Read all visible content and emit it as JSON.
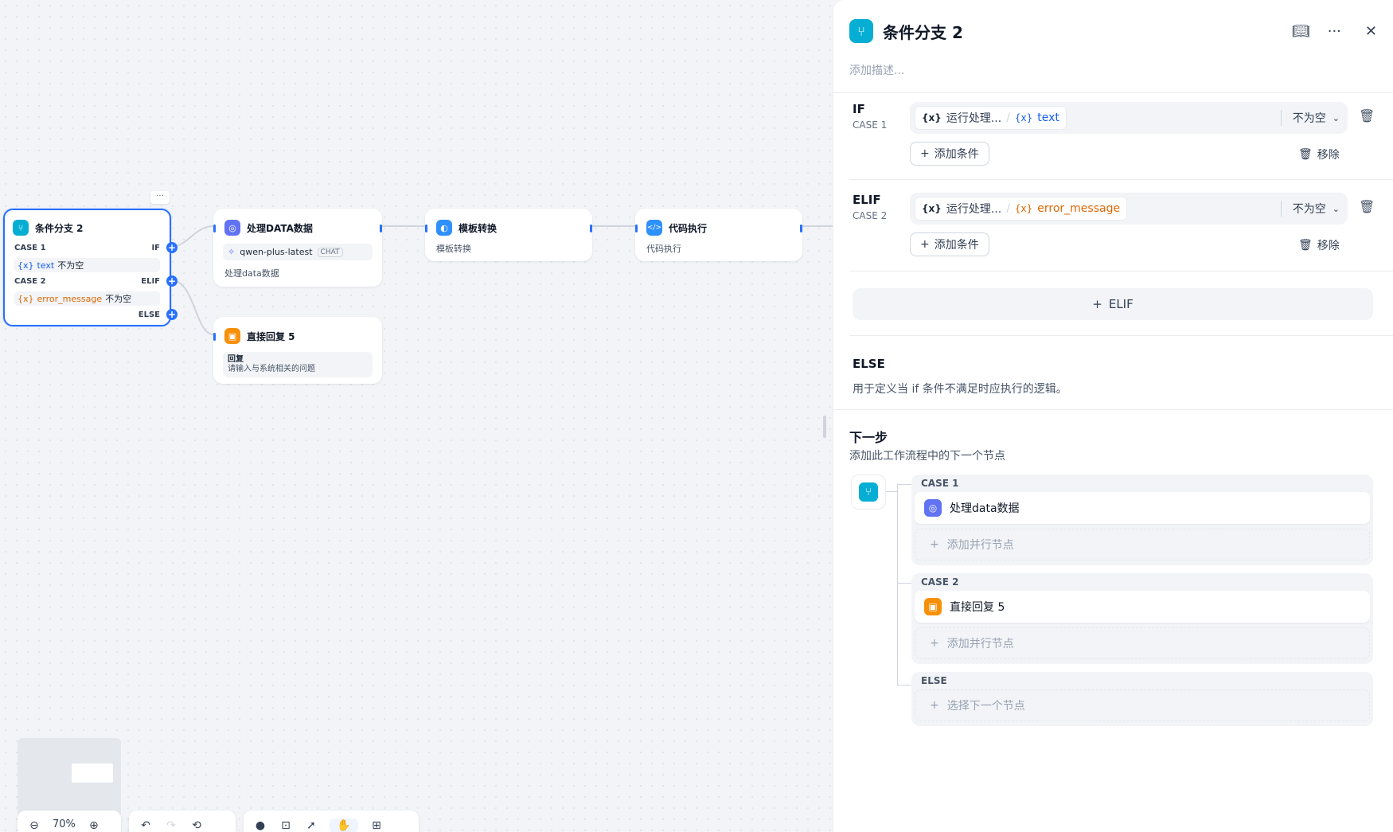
{
  "canvas": {
    "nodes": {
      "if_node": {
        "title": "条件分支 2",
        "more": "···",
        "case1_label": "CASE 1",
        "if_label": "IF",
        "case1_var": "text",
        "case1_op": "不为空",
        "case2_label": "CASE 2",
        "elif_label": "ELIF",
        "case2_var": "error_message",
        "case2_op": "不为空",
        "else_label": "ELSE",
        "var_prefix": "{x}"
      },
      "llm_node": {
        "title": "处理DATA数据",
        "model": "qwen-plus-latest",
        "model_tag": "CHAT",
        "desc": "处理data数据"
      },
      "template_node": {
        "title": "模板转换",
        "desc": "模板转换"
      },
      "code_node": {
        "title": "代码执行",
        "desc": "代码执行"
      },
      "answer_node": {
        "title": "直接回复 5",
        "label": "回复",
        "desc": "请输入与系统相关的问题"
      }
    },
    "toolbar": {
      "zoom": "70%"
    }
  },
  "panel": {
    "title": "条件分支 2",
    "description_placeholder": "添加描述...",
    "if": {
      "label": "IF",
      "case": "CASE 1",
      "var_source": "运行处理...",
      "var_name": "text",
      "operator": "不为空",
      "add_condition": "添加条件",
      "remove": "移除"
    },
    "elif": {
      "label": "ELIF",
      "case": "CASE 2",
      "var_source": "运行处理...",
      "var_name": "error_message",
      "operator": "不为空",
      "add_condition": "添加条件",
      "remove": "移除"
    },
    "add_elif": "ELIF",
    "else": {
      "label": "ELSE",
      "desc": "用于定义当 if 条件不满足时应执行的逻辑。"
    },
    "next_step": {
      "title": "下一步",
      "desc": "添加此工作流程中的下一个节点",
      "case1": {
        "label": "CASE 1",
        "node": "处理data数据",
        "add": "添加并行节点"
      },
      "case2": {
        "label": "CASE 2",
        "node": "直接回复 5",
        "add": "添加并行节点"
      },
      "else": {
        "label": "ELSE",
        "add": "选择下一个节点"
      }
    }
  },
  "colors": {
    "accent": "#2970ff",
    "if_node": "#06aed4",
    "llm": "#6172f3",
    "template": "#2e90fa",
    "code": "#2e90fa",
    "answer": "#f79009",
    "var_blue": "#155eef",
    "var_orange": "#dc6803"
  }
}
